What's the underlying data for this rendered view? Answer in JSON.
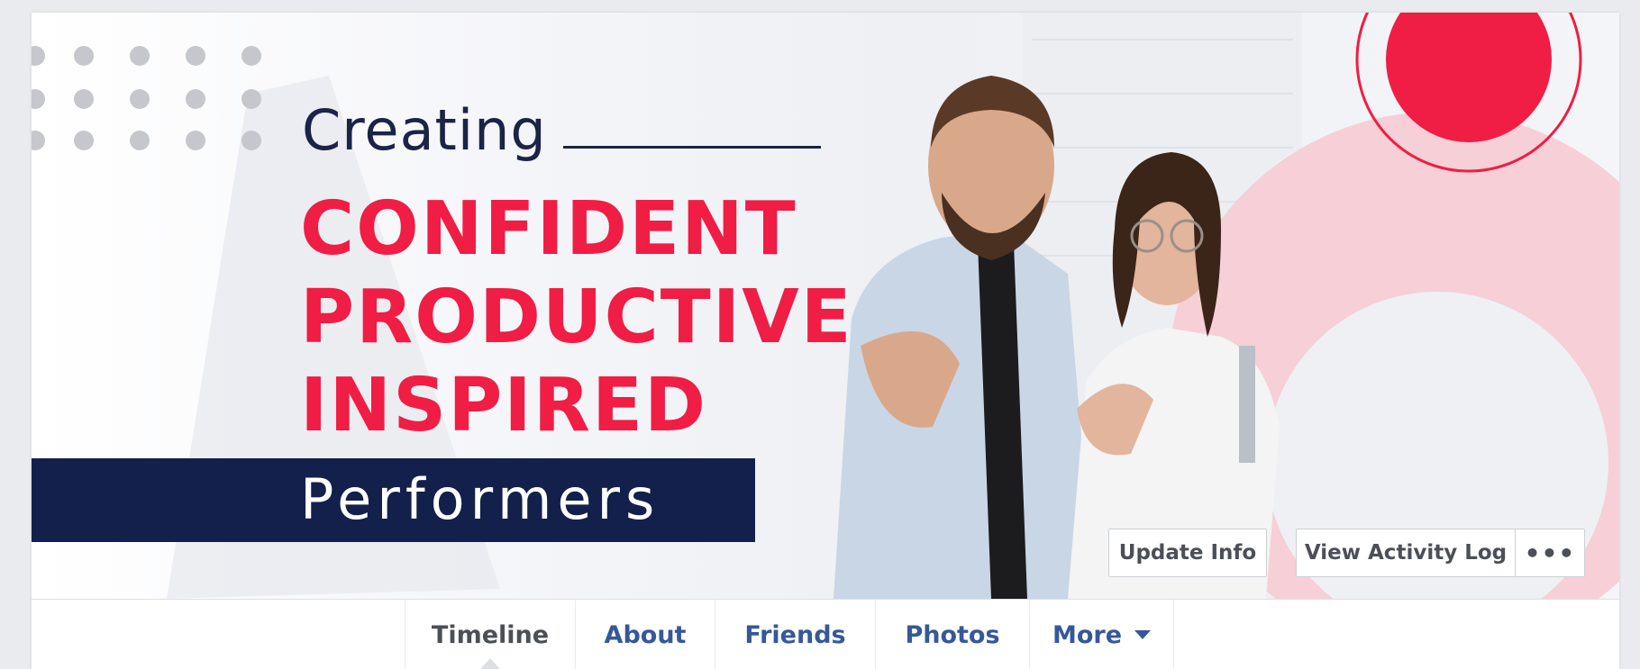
{
  "cover": {
    "line_creating": "Creating",
    "line_1": "CONFIDENT",
    "line_2": "PRODUCTIVE",
    "line_3": "INSPIRED",
    "line_performers": "Performers",
    "accent_color": "#f01d44",
    "navy_color": "#13204b"
  },
  "cover_actions": {
    "update_info": "Update Info",
    "view_activity_log": "View Activity Log",
    "more_icon": "•••"
  },
  "tabs": [
    {
      "label": "Timeline",
      "active": true
    },
    {
      "label": "About",
      "active": false
    },
    {
      "label": "Friends",
      "active": false
    },
    {
      "label": "Photos",
      "active": false
    },
    {
      "label": "More",
      "active": false
    }
  ],
  "colors": {
    "link": "#365899",
    "page_bg": "#e9ebee"
  }
}
